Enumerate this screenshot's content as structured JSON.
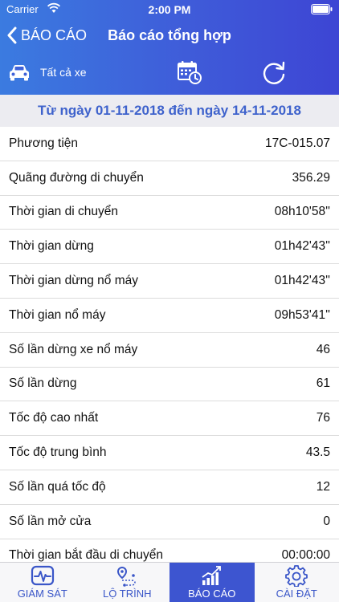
{
  "status_bar": {
    "carrier": "Carrier",
    "time": "2:00 PM"
  },
  "nav": {
    "back_label": "BÁO CÁO",
    "title": "Báo cáo tổng hợp"
  },
  "toolbar": {
    "vehicle_filter": "Tất cả xe"
  },
  "date_range": "Từ ngày 01-11-2018 đến ngày 14-11-2018",
  "report_rows": [
    {
      "label": "Phương tiện",
      "value": "17C-015.07"
    },
    {
      "label": "Quãng đường di chuyển",
      "value": "356.29"
    },
    {
      "label": "Thời gian di chuyển",
      "value": "08h10'58''"
    },
    {
      "label": "Thời gian dừng",
      "value": "01h42'43''"
    },
    {
      "label": "Thời gian dừng nổ máy",
      "value": "01h42'43''"
    },
    {
      "label": "Thời gian nổ máy",
      "value": "09h53'41''"
    },
    {
      "label": "Số lần dừng xe nổ máy",
      "value": "46"
    },
    {
      "label": "Số lần dừng",
      "value": "61"
    },
    {
      "label": "Tốc độ cao nhất",
      "value": "76"
    },
    {
      "label": "Tốc độ trung bình",
      "value": "43.5"
    },
    {
      "label": "Số lần quá tốc độ",
      "value": "12"
    },
    {
      "label": "Số lần mở cửa",
      "value": "0"
    },
    {
      "label": "Thời gian bắt đầu di chuyển",
      "value": "00:00:00"
    }
  ],
  "tabbar": {
    "tabs": [
      {
        "label": "GIÁM SÁT",
        "icon": "monitor-icon",
        "active": false
      },
      {
        "label": "LỘ TRÌNH",
        "icon": "route-icon",
        "active": false
      },
      {
        "label": "BÁO CÁO",
        "icon": "report-chart-icon",
        "active": true
      },
      {
        "label": "CÀI ĐẶT",
        "icon": "gear-icon",
        "active": false
      }
    ]
  },
  "colors": {
    "header_start": "#3b7be0",
    "header_end": "#3d45d4",
    "date_text": "#3e62cc",
    "tab_active_bg": "#3d55d0"
  }
}
